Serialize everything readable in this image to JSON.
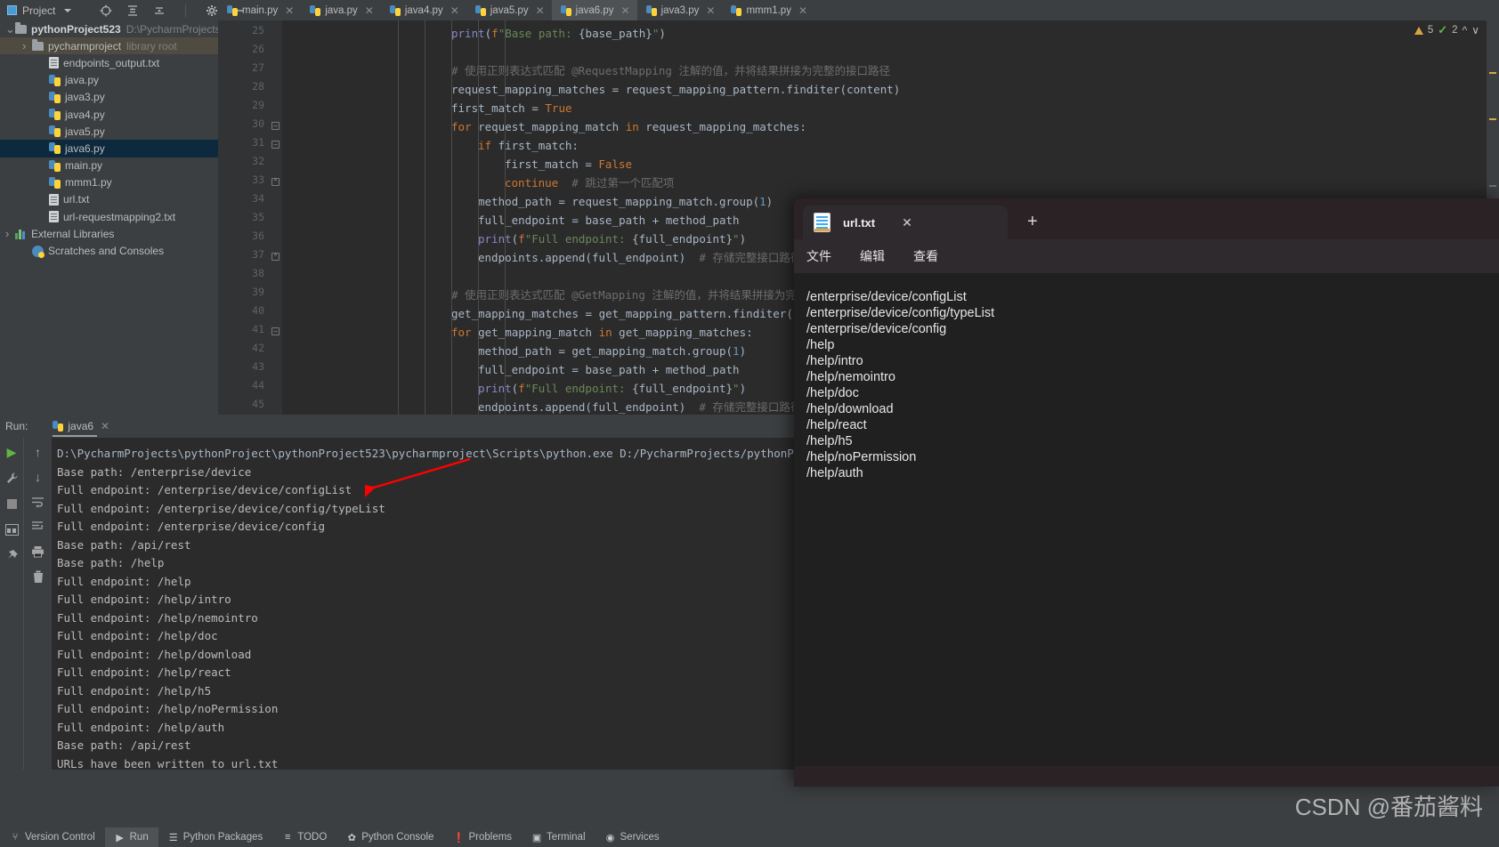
{
  "toolbar": {
    "project_label": "Project",
    "icons": [
      "locate-icon",
      "collapse-all-icon",
      "expand-icon",
      "settings-gear-icon",
      "minimize-icon"
    ]
  },
  "tabs": [
    {
      "label": "main.py",
      "active": false
    },
    {
      "label": "java.py",
      "active": false
    },
    {
      "label": "java4.py",
      "active": false
    },
    {
      "label": "java5.py",
      "active": false
    },
    {
      "label": "java6.py",
      "active": true
    },
    {
      "label": "java3.py",
      "active": false
    },
    {
      "label": "mmm1.py",
      "active": false
    }
  ],
  "project_tree": [
    {
      "label": "pythonProject523",
      "sub": "D:\\PycharmProjects",
      "kind": "folder",
      "indent": 0,
      "arrow": "v",
      "bold": true,
      "state": ""
    },
    {
      "label": "pycharmproject",
      "sub": "library root",
      "kind": "folder",
      "indent": 1,
      "arrow": ">",
      "bold": false,
      "state": "highlight"
    },
    {
      "label": "endpoints_output.txt",
      "sub": "",
      "kind": "text",
      "indent": 2,
      "arrow": "",
      "bold": false,
      "state": ""
    },
    {
      "label": "java.py",
      "sub": "",
      "kind": "python",
      "indent": 2,
      "arrow": "",
      "bold": false,
      "state": ""
    },
    {
      "label": "java3.py",
      "sub": "",
      "kind": "python",
      "indent": 2,
      "arrow": "",
      "bold": false,
      "state": ""
    },
    {
      "label": "java4.py",
      "sub": "",
      "kind": "python",
      "indent": 2,
      "arrow": "",
      "bold": false,
      "state": ""
    },
    {
      "label": "java5.py",
      "sub": "",
      "kind": "python",
      "indent": 2,
      "arrow": "",
      "bold": false,
      "state": ""
    },
    {
      "label": "java6.py",
      "sub": "",
      "kind": "python",
      "indent": 2,
      "arrow": "",
      "bold": false,
      "state": "selected"
    },
    {
      "label": "main.py",
      "sub": "",
      "kind": "python",
      "indent": 2,
      "arrow": "",
      "bold": false,
      "state": ""
    },
    {
      "label": "mmm1.py",
      "sub": "",
      "kind": "python",
      "indent": 2,
      "arrow": "",
      "bold": false,
      "state": ""
    },
    {
      "label": "url.txt",
      "sub": "",
      "kind": "text",
      "indent": 2,
      "arrow": "",
      "bold": false,
      "state": ""
    },
    {
      "label": "url-requestmapping2.txt",
      "sub": "",
      "kind": "text",
      "indent": 2,
      "arrow": "",
      "bold": false,
      "state": ""
    },
    {
      "label": "External Libraries",
      "sub": "",
      "kind": "library",
      "indent": 0,
      "arrow": ">",
      "bold": false,
      "state": ""
    },
    {
      "label": "Scratches and Consoles",
      "sub": "",
      "kind": "scratch",
      "indent": 1,
      "arrow": "",
      "bold": false,
      "state": ""
    }
  ],
  "editor": {
    "first_line_number": 25,
    "lines": [
      {
        "n": 25,
        "indent": 8,
        "text": "print(f\"Base path: {base_path}\")"
      },
      {
        "n": 26,
        "indent": 0,
        "text": ""
      },
      {
        "n": 27,
        "indent": 8,
        "text": "# 使用正则表达式匹配 @RequestMapping 注解的值，并将结果拼接为完整的接口路径"
      },
      {
        "n": 28,
        "indent": 8,
        "text": "request_mapping_matches = request_mapping_pattern.finditer(content)"
      },
      {
        "n": 29,
        "indent": 8,
        "text": "first_match = True"
      },
      {
        "n": 30,
        "indent": 8,
        "text": "for request_mapping_match in request_mapping_matches:"
      },
      {
        "n": 31,
        "indent": 12,
        "text": "if first_match:"
      },
      {
        "n": 32,
        "indent": 16,
        "text": "first_match = False"
      },
      {
        "n": 33,
        "indent": 16,
        "text": "continue  # 跳过第一个匹配项"
      },
      {
        "n": 34,
        "indent": 12,
        "text": "method_path = request_mapping_match.group(1)"
      },
      {
        "n": 35,
        "indent": 12,
        "text": "full_endpoint = base_path + method_path"
      },
      {
        "n": 36,
        "indent": 12,
        "text": "print(f\"Full endpoint: {full_endpoint}\")"
      },
      {
        "n": 37,
        "indent": 12,
        "text": "endpoints.append(full_endpoint)  # 存储完整接口路径"
      },
      {
        "n": 38,
        "indent": 0,
        "text": ""
      },
      {
        "n": 39,
        "indent": 8,
        "text": "# 使用正则表达式匹配 @GetMapping 注解的值，并将结果拼接为完整的接口路径"
      },
      {
        "n": 40,
        "indent": 8,
        "text": "get_mapping_matches = get_mapping_pattern.finditer(content)"
      },
      {
        "n": 41,
        "indent": 8,
        "text": "for get_mapping_match in get_mapping_matches:"
      },
      {
        "n": 42,
        "indent": 12,
        "text": "method_path = get_mapping_match.group(1)"
      },
      {
        "n": 43,
        "indent": 12,
        "text": "full_endpoint = base_path + method_path"
      },
      {
        "n": 44,
        "indent": 12,
        "text": "print(f\"Full endpoint: {full_endpoint}\")"
      },
      {
        "n": 45,
        "indent": 12,
        "text": "endpoints.append(full_endpoint)  # 存储完整接口路径"
      }
    ],
    "warning_count": "5",
    "ok_count": "2"
  },
  "run_panel": {
    "run_label": "Run:",
    "run_tab_label": "java6",
    "tool_icons": [
      "rerun-play-icon",
      "wrench-icon",
      "stop-icon",
      "layout-icon",
      "pin-icon"
    ],
    "tool_icons2": [
      "up-arrow-icon",
      "down-arrow-icon",
      "soft-wrap-icon",
      "scroll-to-end-icon",
      "print-icon",
      "trash-icon"
    ],
    "console_lines": [
      "D:\\PycharmProjects\\pythonProject\\pythonProject523\\pycharmproject\\Scripts\\python.exe D:/PycharmProjects/pythonP",
      "Base path: /enterprise/device",
      "Full endpoint: /enterprise/device/configList",
      "Full endpoint: /enterprise/device/config/typeList",
      "Full endpoint: /enterprise/device/config",
      "Base path: /api/rest",
      "Base path: /help",
      "Full endpoint: /help",
      "Full endpoint: /help/intro",
      "Full endpoint: /help/nemointro",
      "Full endpoint: /help/doc",
      "Full endpoint: /help/download",
      "Full endpoint: /help/react",
      "Full endpoint: /help/h5",
      "Full endpoint: /help/noPermission",
      "Full endpoint: /help/auth",
      "Base path: /api/rest",
      "URLs have been written to url.txt"
    ]
  },
  "status_bar": [
    {
      "label": "Version Control",
      "icon": "branch-icon",
      "active": false
    },
    {
      "label": "Run",
      "icon": "play-icon",
      "active": true
    },
    {
      "label": "Python Packages",
      "icon": "packages-icon",
      "active": false
    },
    {
      "label": "TODO",
      "icon": "todo-list-icon",
      "active": false
    },
    {
      "label": "Python Console",
      "icon": "python-console-icon",
      "active": false
    },
    {
      "label": "Problems",
      "icon": "problems-icon",
      "active": false
    },
    {
      "label": "Terminal",
      "icon": "terminal-icon",
      "active": false
    },
    {
      "label": "Services",
      "icon": "services-icon",
      "active": false
    }
  ],
  "notepad": {
    "tab_title": "url.txt",
    "close_label": "✕",
    "new_tab_label": "+",
    "menus": [
      "文件",
      "编辑",
      "查看"
    ],
    "lines": [
      "/enterprise/device/configList",
      "/enterprise/device/config/typeList",
      "/enterprise/device/config",
      "/help",
      "/help/intro",
      "/help/nemointro",
      "/help/doc",
      "/help/download",
      "/help/react",
      "/help/h5",
      "/help/noPermission",
      "/help/auth"
    ]
  },
  "watermark": "CSDN @番茄酱料",
  "colors": {
    "accent_blue": "#4a9ad4",
    "panel_bg": "#3c3f41",
    "editor_bg": "#2b2b2b",
    "selection": "#0d293e",
    "warning": "#d9a343",
    "ok_green": "#62b543",
    "annotation_red": "#ff0000"
  }
}
